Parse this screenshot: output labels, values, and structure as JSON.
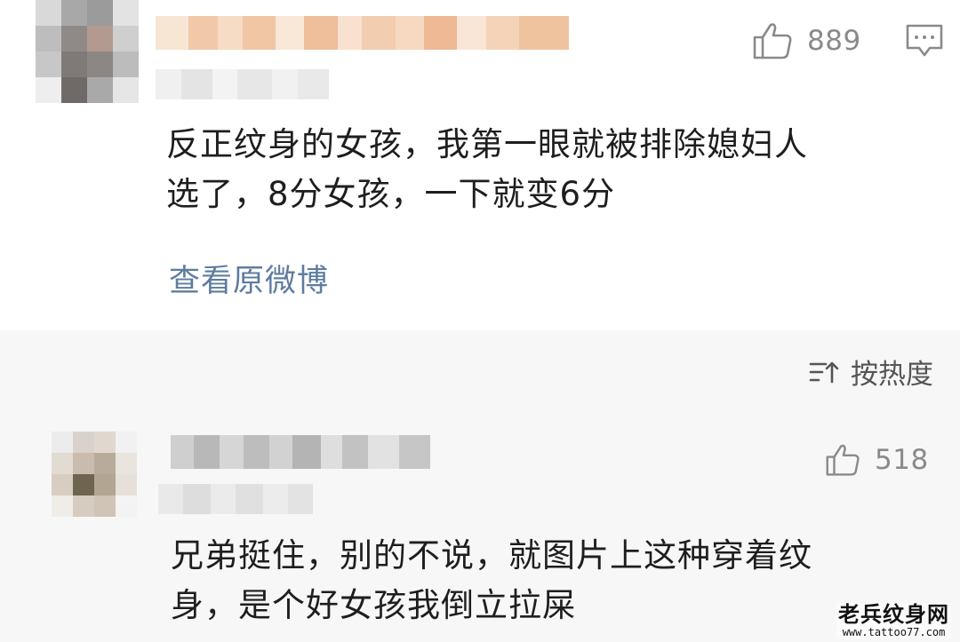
{
  "comments": [
    {
      "likes": "889",
      "text_lines": [
        "反正纹身的女孩，我第一眼就被排除媳妇人",
        "选了，8分女孩，一下就变6分"
      ],
      "view_original_label": "查看原微博"
    },
    {
      "likes": "518",
      "text_lines": [
        "兄弟挺住，别的不说，就图片上这种穿着纹",
        "身，是个好女孩我倒立拉屎"
      ]
    }
  ],
  "sort": {
    "label": "按热度",
    "icon": "sort-icon"
  },
  "icons": {
    "like": "thumbs-up-icon",
    "reply": "comment-bubble-icon"
  },
  "watermark": {
    "title": "老兵纹身网",
    "url": "www.tattoo77.com"
  },
  "colors": {
    "link": "#5e7c9f",
    "muted": "#8a8a8a",
    "card_bg": "#ffffff",
    "section_bg": "#f7f7f7"
  }
}
